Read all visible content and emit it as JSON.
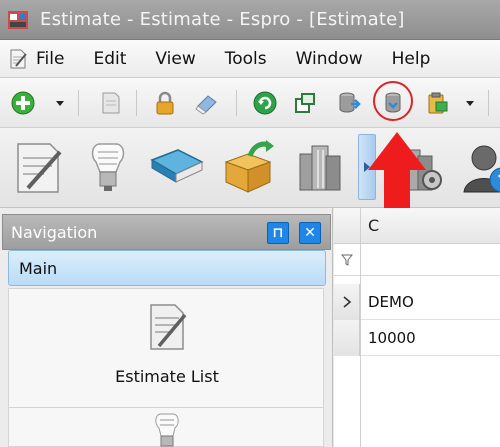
{
  "window": {
    "title": "Estimate - Estimate - Espro - [Estimate]"
  },
  "menu": {
    "items": [
      "File",
      "Edit",
      "View",
      "Tools",
      "Window",
      "Help"
    ]
  },
  "toolbar": {
    "icons": [
      "add-icon",
      "document-icon",
      "lock-icon",
      "eraser-icon",
      "refresh-icon",
      "window-restore-icon",
      "database-export-icon",
      "database-sync-icon",
      "clipboard-icon"
    ],
    "highlighted": "database-sync-icon"
  },
  "ribbon": {
    "icons": [
      "notepad-icon",
      "lightbulb-icon",
      "book-icon",
      "open-box-icon",
      "building-icon",
      "building-gear-icon",
      "user-help-icon"
    ]
  },
  "navigation": {
    "title": "Navigation",
    "pin_label": "⊓",
    "close_label": "✕",
    "tab": "Main",
    "items": [
      {
        "label": "Estimate List",
        "icon": "notepad-icon"
      },
      {
        "label": "",
        "icon": "lightbulb-icon"
      }
    ]
  },
  "grid": {
    "column_header": "C",
    "rows": [
      {
        "value": "DEMO",
        "current": true
      },
      {
        "value": "10000",
        "current": false
      }
    ]
  },
  "colors": {
    "accent_blue": "#1f86e8",
    "highlight_red": "#d8262a",
    "tab_blue": "#b9dbf6"
  }
}
